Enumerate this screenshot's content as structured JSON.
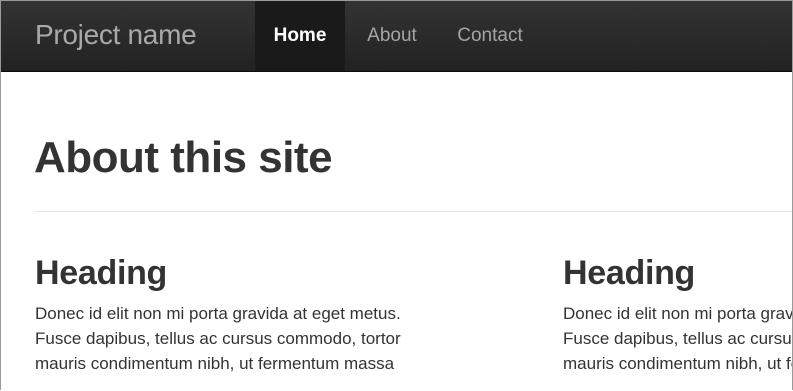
{
  "navbar": {
    "brand": "Project name",
    "items": [
      {
        "label": "Home",
        "active": true
      },
      {
        "label": "About",
        "active": false
      },
      {
        "label": "Contact",
        "active": false
      }
    ]
  },
  "main": {
    "title": "About this site",
    "columns": [
      {
        "heading": "Heading",
        "lines": [
          "Donec id elit non mi porta gravida at eget metus.",
          "Fusce dapibus, tellus ac cursus commodo, tortor",
          "mauris condimentum nibh, ut fermentum massa"
        ]
      },
      {
        "heading": "Heading",
        "lines": [
          "Donec id elit non mi porta gravida at eget metus.",
          "Fusce dapibus, tellus ac cursus commodo, tortor",
          "mauris condimentum nibh, ut fermentum massa"
        ]
      }
    ]
  },
  "colors": {
    "navbar_background": "#222222",
    "active_nav_background": "#1a1a1a",
    "nav_text": "#a5a5a5",
    "text": "#333333"
  }
}
